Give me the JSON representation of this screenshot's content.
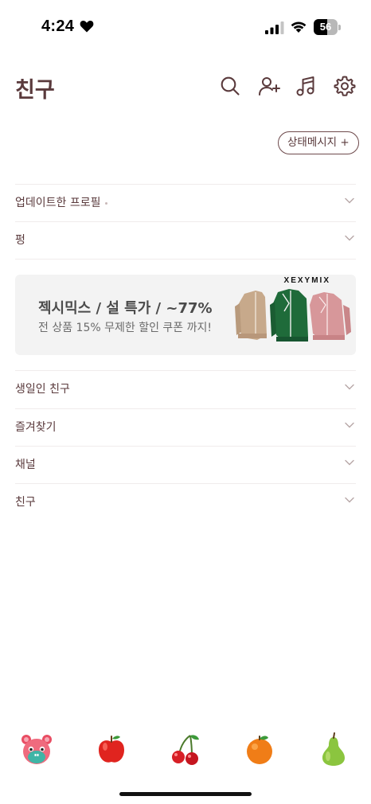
{
  "status_bar": {
    "time": "4:24",
    "battery": "56",
    "battery_level": 0.56
  },
  "header": {
    "title": "친구",
    "icons": [
      "search-icon",
      "add-friend-icon",
      "music-icon",
      "settings-icon"
    ]
  },
  "status_message_button": "상태메시지 +",
  "sections": [
    {
      "label": "업데이트한 프로필"
    },
    {
      "label": "펑"
    }
  ],
  "ad": {
    "brand": "XEXYMIX",
    "title": "젝시믹스 / 설 특가 / ~77%",
    "subtitle": "전 상품 15% 무제한 할인 쿠폰 까지!"
  },
  "sections_after_ad": [
    {
      "label": "생일인 친구"
    },
    {
      "label": "즐겨찾기"
    },
    {
      "label": "채널"
    },
    {
      "label": "친구"
    }
  ],
  "bottom_tabs": [
    "character-tab-icon",
    "apple-tab-icon",
    "cherry-tab-icon",
    "orange-tab-icon",
    "pear-tab-icon"
  ],
  "colors": {
    "text_primary": "#5a3a3c",
    "divider": "#f0ecec",
    "banner_bg": "#f3f3f3"
  }
}
